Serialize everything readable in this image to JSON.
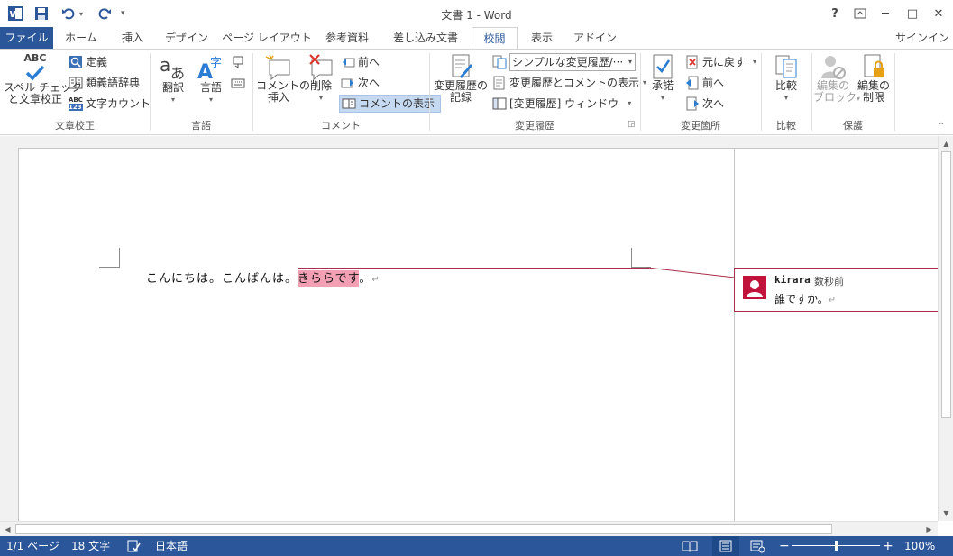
{
  "window": {
    "title": "文書 1 - Word",
    "help_label": "?",
    "minimize_label": "─",
    "maximize_label": "□",
    "close_label": "✕"
  },
  "tabs": [
    {
      "label": "ファイル"
    },
    {
      "label": "ホーム"
    },
    {
      "label": "挿入"
    },
    {
      "label": "デザイン"
    },
    {
      "label": "ページ レイアウト"
    },
    {
      "label": "参考資料"
    },
    {
      "label": "差し込み文書"
    },
    {
      "label": "校閲"
    },
    {
      "label": "表示"
    },
    {
      "label": "アドイン"
    }
  ],
  "signin_label": "サインイン",
  "ribbon": {
    "proofing": {
      "group_label": "文章校正",
      "spell_abc": "ABC",
      "spell_label_1": "スペル チェック",
      "spell_label_2": "と文章校正",
      "define_label": "定義",
      "thesaurus_label": "類義語辞典",
      "wordcount_label": "文字カウント",
      "wordcount_badge_top": "ABC",
      "wordcount_badge_bottom": "123"
    },
    "language": {
      "group_label": "言語",
      "translate_label": "翻訳",
      "language_label": "言語"
    },
    "comments": {
      "group_label": "コメント",
      "new_comment_label_1": "コメントの",
      "new_comment_label_2": "挿入",
      "delete_label": "削除",
      "prev_label": "前へ",
      "next_label": "次へ",
      "show_comments_label": "コメントの表示"
    },
    "tracking": {
      "group_label": "変更履歴",
      "track_changes_label_1": "変更履歴の",
      "track_changes_label_2": "記録",
      "markup_dropdown_value": "シンプルな変更履歴/···",
      "show_markup_label": "変更履歴とコメントの表示",
      "reviewing_pane_label": "[変更履歴] ウィンドウ"
    },
    "changes": {
      "group_label": "変更箇所",
      "accept_label": "承諾",
      "reject_label": "元に戻す",
      "prev_label": "前へ",
      "next_label": "次へ"
    },
    "compare": {
      "group_label": "比較",
      "compare_label": "比較"
    },
    "protect": {
      "group_label": "保護",
      "block_authors_label_1": "編集の",
      "block_authors_label_2": "ブロック",
      "restrict_editing_label_1": "編集の",
      "restrict_editing_label_2": "制限"
    }
  },
  "document": {
    "text_before": "こんにちは。こんばんは。",
    "text_highlighted": "きららです",
    "text_after": "。",
    "paragraph_mark": "↵"
  },
  "comment": {
    "author": "kirara",
    "time": "数秒前",
    "text": "誰ですか。"
  },
  "statusbar": {
    "page": "1/1 ページ",
    "word_count": "18 文字",
    "language": "日本語",
    "zoom": "100%",
    "zoom_level": 0.5
  },
  "colors": {
    "accent": "#2b579a",
    "comment_border": "#a8304a",
    "highlight": "#f3a0b5",
    "avatar": "#c0143c"
  }
}
